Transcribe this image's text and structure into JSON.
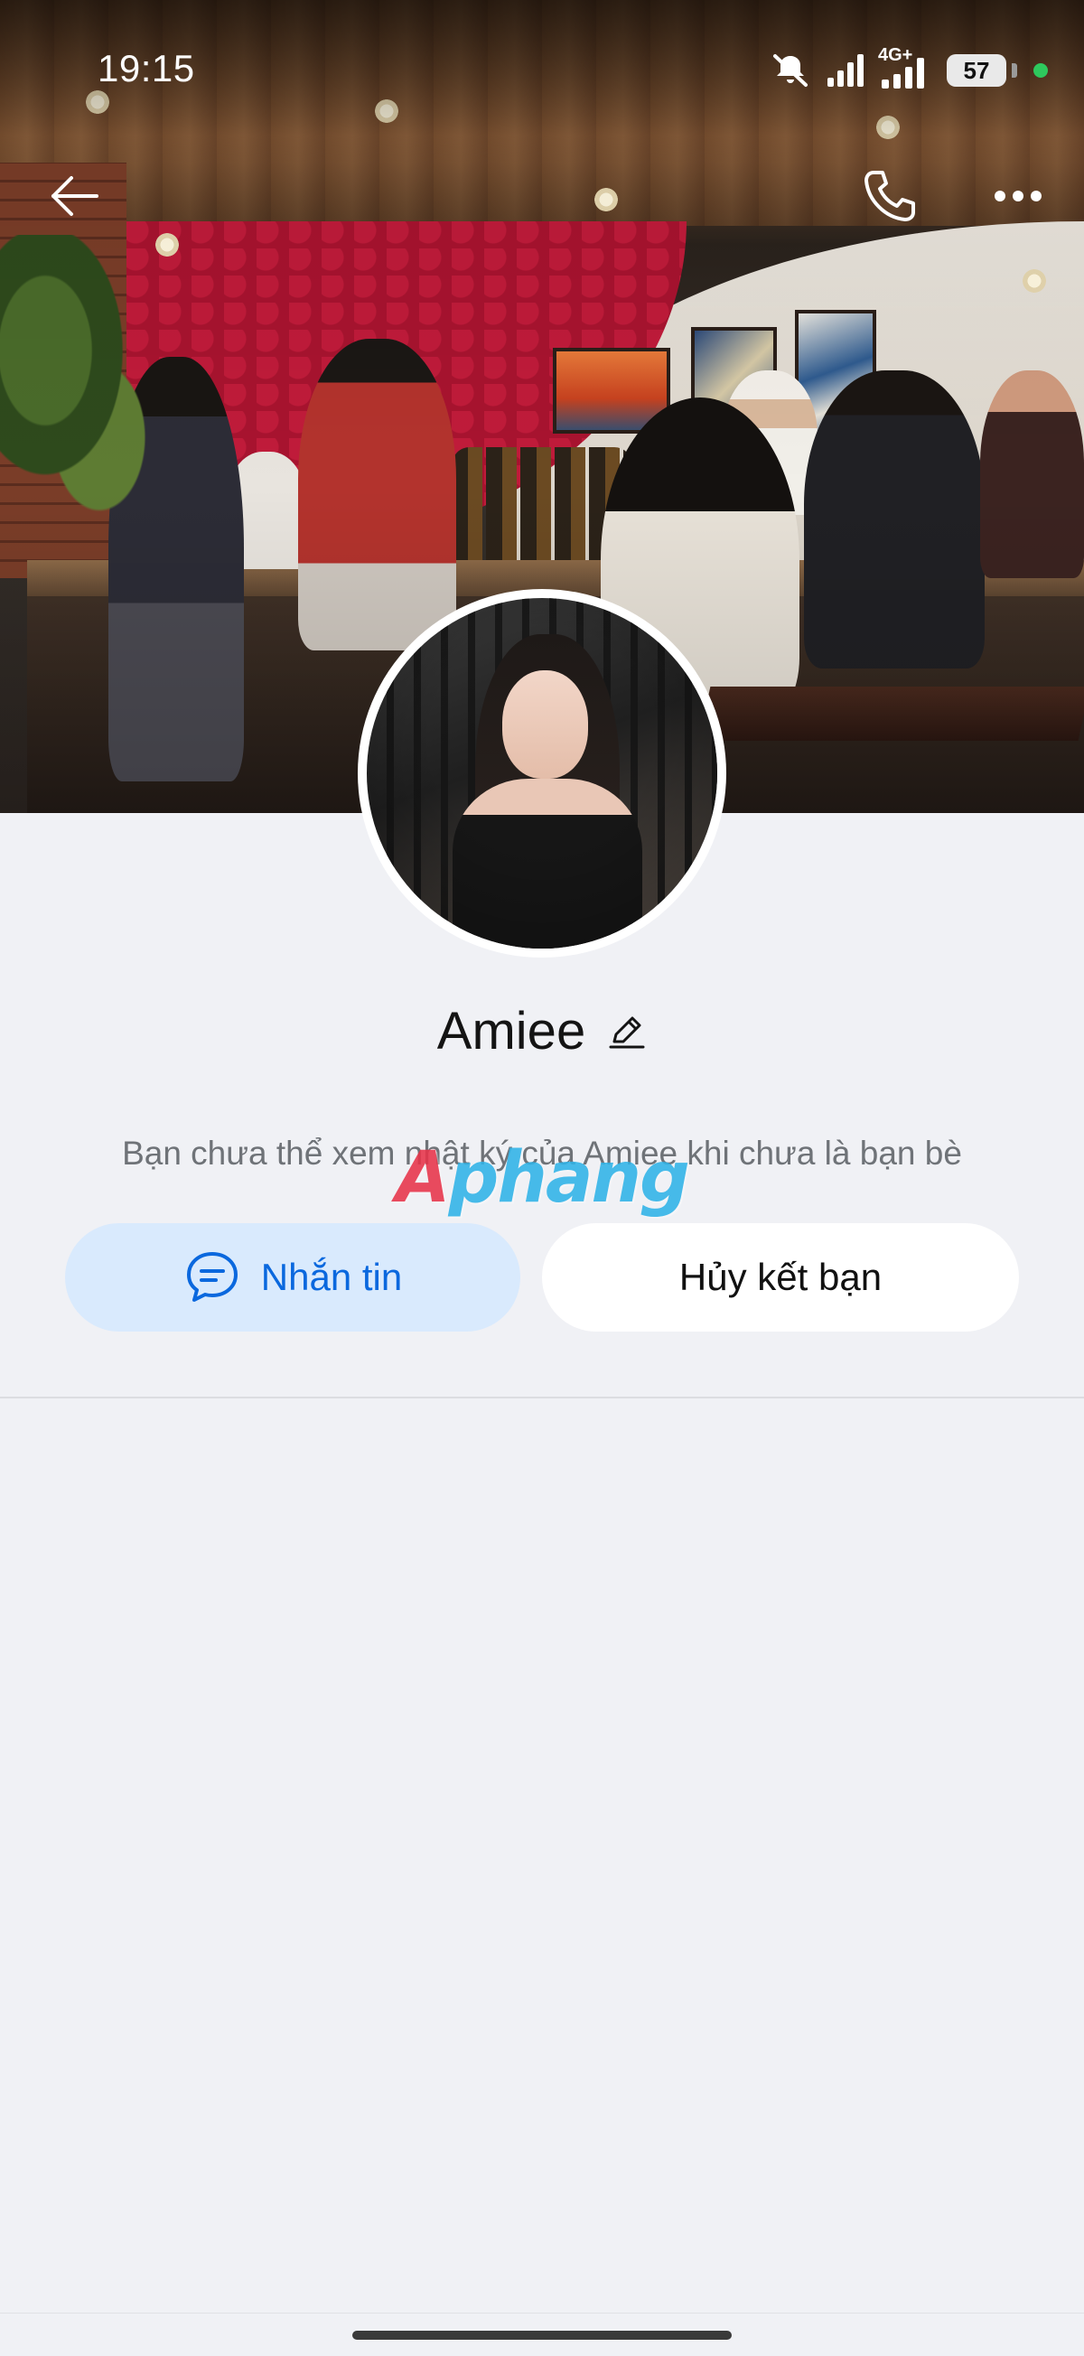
{
  "status_bar": {
    "time": "19:15",
    "network_label": "4G+",
    "battery_level": "57",
    "icons": [
      "mute-icon",
      "signal-icon",
      "4g-signal-icon",
      "battery-icon",
      "privacy-dot-icon"
    ]
  },
  "header": {
    "back_icon": "arrow-left-icon",
    "call_icon": "phone-icon",
    "more_icon": "more-horizontal-icon"
  },
  "profile": {
    "name": "Amiee",
    "edit_icon": "pencil-icon",
    "info_text": "Bạn chưa thể xem nhật ký của Amiee khi chưa là bạn bè"
  },
  "watermark": {
    "text_first": "A",
    "text_rest": "phang"
  },
  "actions": {
    "message_label": "Nhắn tin",
    "message_icon": "chat-bubble-icon",
    "unfriend_label": "Hủy kết bạn"
  },
  "colors": {
    "background": "#f0f1f5",
    "accent": "#0a68de",
    "accent_bg": "#d9eafd"
  }
}
